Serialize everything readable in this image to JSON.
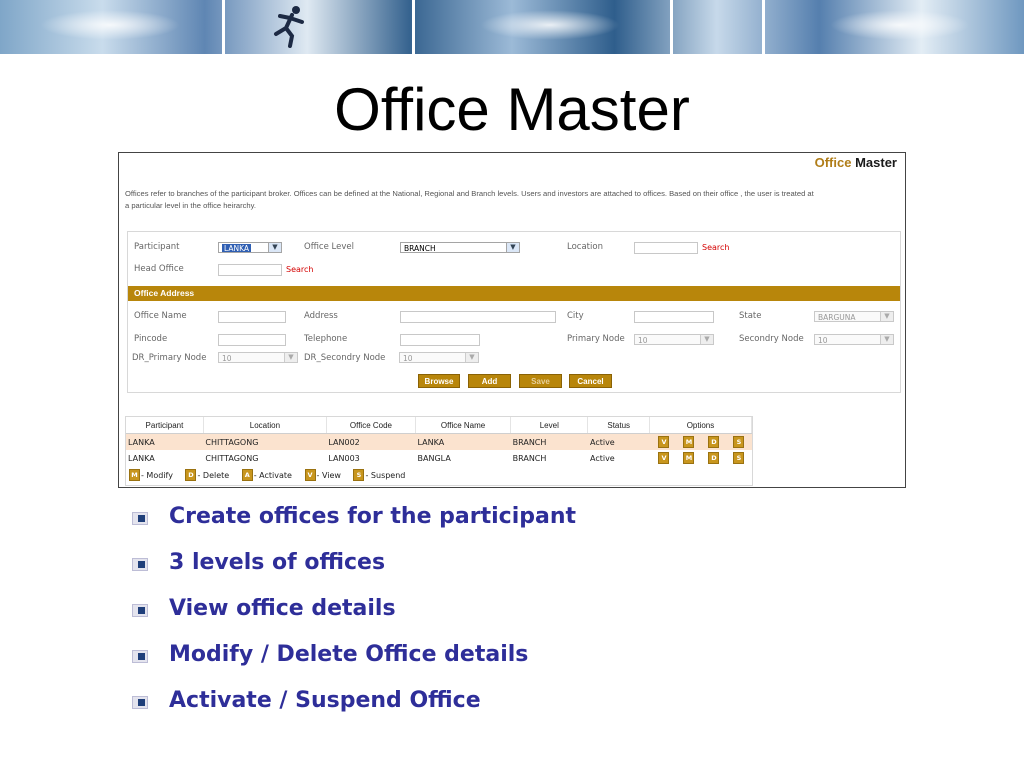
{
  "slide": {
    "title": "Office Master",
    "bullets": [
      "Create offices for the participant",
      "3 levels of offices",
      "View office details",
      "Modify / Delete Office details",
      "Activate / Suspend Office"
    ]
  },
  "app": {
    "title_part1": "Office",
    "title_part2": "Master",
    "description": "Offices refer to branches of the participant broker. Offices can be defined at the National, Regional and Branch levels. Users and investors are attached to offices. Based on their office , the user is treated at a particular level in the office heirarchy.",
    "search_label": "Search",
    "fields": {
      "participant_label": "Participant",
      "participant_value": "LANKA",
      "office_level_label": "Office Level",
      "office_level_value": "BRANCH",
      "location_label": "Location",
      "head_office_label": "Head Office"
    },
    "office_address": {
      "section_title": "Office Address",
      "office_name_label": "Office Name",
      "address_label": "Address",
      "city_label": "City",
      "state_label": "State",
      "state_value": "BARGUNA",
      "pincode_label": "Pincode",
      "telephone_label": "Telephone",
      "primary_node_label": "Primary Node",
      "primary_node_value": "10",
      "secondry_node_label": "Secondry Node",
      "secondry_node_value": "10",
      "dr_primary_node_label": "DR_Primary Node",
      "dr_primary_node_value": "10",
      "dr_secondry_node_label": "DR_Secondry Node",
      "dr_secondry_node_value": "10"
    },
    "buttons": {
      "browse": "Browse",
      "add": "Add",
      "save": "Save",
      "cancel": "Cancel"
    },
    "table": {
      "columns": [
        "Participant",
        "Location",
        "Office Code",
        "Office Name",
        "Level",
        "Status",
        "Options"
      ],
      "rows": [
        {
          "participant": "LANKA",
          "location": "CHITTAGONG",
          "office_code": "LAN002",
          "office_name": "LANKA",
          "level": "BRANCH",
          "status": "Active"
        },
        {
          "participant": "LANKA",
          "location": "CHITTAGONG",
          "office_code": "LAN003",
          "office_name": "BANGLA",
          "level": "BRANCH",
          "status": "Active"
        }
      ],
      "option_icons": [
        "V",
        "M",
        "D",
        "S"
      ]
    },
    "legend": [
      {
        "key": "M",
        "text": "- Modify"
      },
      {
        "key": "D",
        "text": "- Delete"
      },
      {
        "key": "A",
        "text": "- Activate"
      },
      {
        "key": "V",
        "text": "- View"
      },
      {
        "key": "S",
        "text": "- Suspend"
      }
    ]
  }
}
